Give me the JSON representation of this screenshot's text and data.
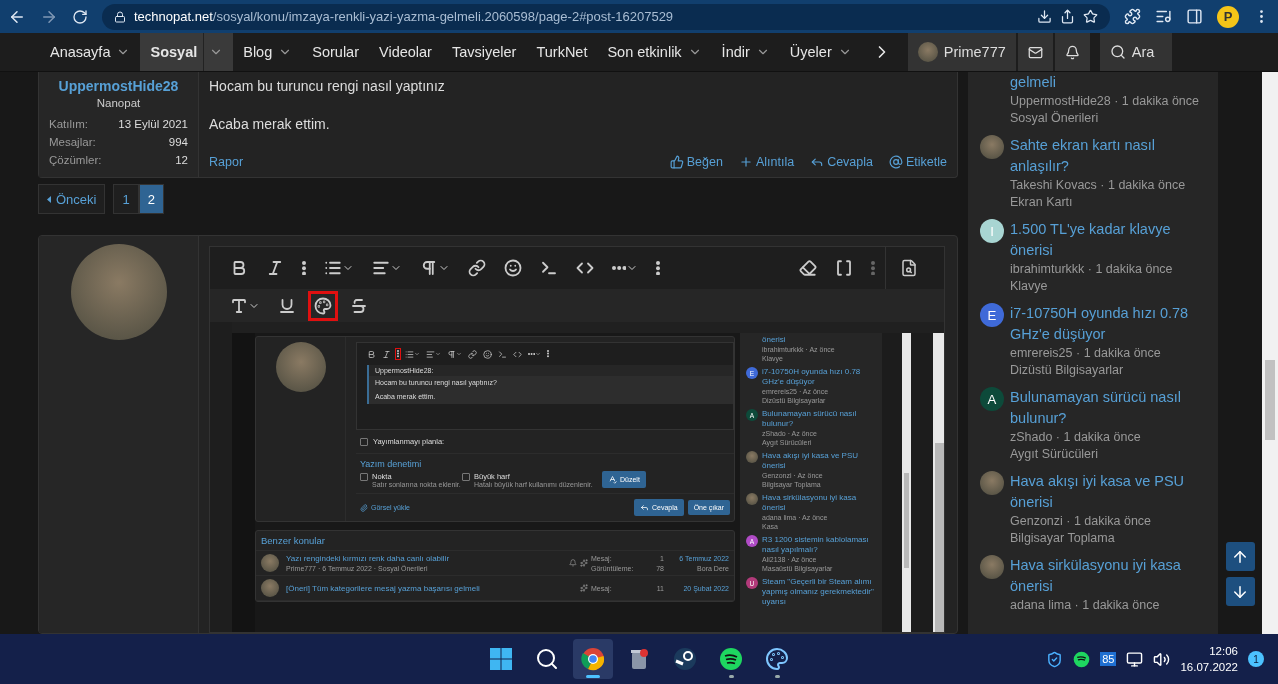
{
  "browser": {
    "url_host": "technopat.net",
    "url_path": "/sosyal/konu/imzaya-renkli-yazi-yazma-gelmeli.2060598/page-2#post-16207529",
    "profile_initial": "P"
  },
  "nav": {
    "items": [
      {
        "label": "Anasayfa",
        "selected": false,
        "dropdown": true
      },
      {
        "label": "Sosyal",
        "selected": true,
        "dropdown": true
      },
      {
        "label": "Blog",
        "selected": false,
        "dropdown": true
      },
      {
        "label": "Sorular",
        "selected": false,
        "dropdown": false
      },
      {
        "label": "Videolar",
        "selected": false,
        "dropdown": false
      },
      {
        "label": "Tavsiyeler",
        "selected": false,
        "dropdown": false
      },
      {
        "label": "TurkNet",
        "selected": false,
        "dropdown": false
      },
      {
        "label": "Son etkinlik",
        "selected": false,
        "dropdown": true
      },
      {
        "label": "İndir",
        "selected": false,
        "dropdown": true
      },
      {
        "label": "Üyeler",
        "selected": false,
        "dropdown": true
      }
    ],
    "user": "Prime777",
    "search": "Ara"
  },
  "post": {
    "author": "UppermostHide28",
    "rank": "Nanopat",
    "stats": [
      {
        "label": "Katılım:",
        "value": "13 Eylül 2021"
      },
      {
        "label": "Mesajlar:",
        "value": "994"
      },
      {
        "label": "Çözümler:",
        "value": "12"
      }
    ],
    "paragraphs": [
      "Hocam bu turuncu rengi nasıl yaptınız",
      "Acaba merak ettim."
    ],
    "report": "Rapor",
    "actions": [
      {
        "kind": "like",
        "label": "Beğen"
      },
      {
        "kind": "quote",
        "label": "Alıntıla"
      },
      {
        "kind": "reply",
        "label": "Cevapla"
      },
      {
        "kind": "mention",
        "label": "Etiketle"
      }
    ]
  },
  "pagination": {
    "prev": "Önceki",
    "pages": [
      {
        "label": "1",
        "selected": false
      },
      {
        "label": "2",
        "selected": true
      }
    ]
  },
  "editor": {
    "toolbar_rows": [
      {
        "tools": [
          {
            "kind": "bold",
            "highlighted": false,
            "dropdown": false
          },
          {
            "kind": "italic",
            "highlighted": false,
            "dropdown": false
          },
          {
            "kind": "more",
            "highlighted": false,
            "dropdown": false
          },
          {
            "kind": "list",
            "highlighted": false,
            "dropdown": true
          },
          {
            "kind": "align",
            "highlighted": false,
            "dropdown": true
          },
          {
            "kind": "paragraph",
            "highlighted": false,
            "dropdown": true
          },
          {
            "kind": "link",
            "highlighted": false,
            "dropdown": false
          },
          {
            "kind": "emoji",
            "highlighted": false,
            "dropdown": false
          },
          {
            "kind": "terminal",
            "highlighted": false,
            "dropdown": false
          },
          {
            "kind": "code",
            "highlighted": false,
            "dropdown": false
          },
          {
            "kind": "insert",
            "highlighted": false,
            "dropdown": true
          },
          {
            "kind": "more",
            "highlighted": false,
            "dropdown": false
          }
        ]
      },
      {
        "tools": [
          {
            "kind": "textsize",
            "highlighted": false,
            "dropdown": true
          },
          {
            "kind": "underline",
            "highlighted": false,
            "dropdown": false
          },
          {
            "kind": "palette",
            "highlighted": true,
            "dropdown": false
          },
          {
            "kind": "strike",
            "highlighted": false,
            "dropdown": false
          }
        ]
      }
    ],
    "right_tools": [
      {
        "kind": "eraser",
        "highlighted": false,
        "dropdown": false
      },
      {
        "kind": "brackets",
        "highlighted": false,
        "dropdown": false
      }
    ],
    "embedded_screenshot": {
      "toolbar": [
        {
          "kind": "bold",
          "highlighted": false,
          "dropdown": false
        },
        {
          "kind": "italic",
          "highlighted": false,
          "dropdown": false
        },
        {
          "kind": "more",
          "highlighted": true,
          "dropdown": false
        },
        {
          "kind": "list",
          "highlighted": false,
          "dropdown": true
        },
        {
          "kind": "align",
          "highlighted": false,
          "dropdown": true
        },
        {
          "kind": "paragraph",
          "highlighted": false,
          "dropdown": true
        },
        {
          "kind": "link",
          "highlighted": false,
          "dropdown": false
        },
        {
          "kind": "emoji",
          "highlighted": false,
          "dropdown": false
        },
        {
          "kind": "terminal",
          "highlighted": false,
          "dropdown": false
        },
        {
          "kind": "code",
          "highlighted": false,
          "dropdown": false
        },
        {
          "kind": "insert",
          "highlighted": false,
          "dropdown": true
        },
        {
          "kind": "more",
          "highlighted": false,
          "dropdown": false
        }
      ],
      "quote_author": "UppermostHide28:",
      "quote_lines": [
        "Hocam bu turuncu rengi nasıl yaptınız?",
        "Acaba merak ettim."
      ],
      "schedule": {
        "label": "Yayımlanmayı planla:",
        "checked": false
      },
      "spell_title": "Yazım denetimi",
      "spell_options": [
        {
          "label": "Nokta",
          "hint": "Satır sonlarına nokta eklenir.",
          "checked": false
        },
        {
          "label": "Büyük harf",
          "hint": "Hatalı büyük harf kullanımı düzenlenir.",
          "checked": false
        }
      ],
      "fix_button": "Düzelt",
      "upload": "Görsel yükle",
      "buttons": [
        {
          "kind": "reply",
          "label": "Cevapla"
        },
        {
          "kind": "plain",
          "label": "Öne çıkar"
        }
      ],
      "similar": {
        "title": "Benzer konular",
        "rows": [
          {
            "kind": "photo",
            "title": "Yazı rengindeki kırmızı renk daha canlı olabilir",
            "meta": "Prime777 · 6 Temmuz 2022 · Sosyal Önerileri",
            "watched": true,
            "stats": [
              {
                "label": "Mesaj:",
                "value": "1"
              },
              {
                "label": "Görüntüleme:",
                "value": "78"
              }
            ],
            "date": "6 Temmuz 2022",
            "last_user": "Bora Dere"
          },
          {
            "kind": "photo",
            "title": "[Öneri] Tüm kategorilere mesaj yazma başarısı gelmeli",
            "watched": false,
            "stats": [
              {
                "label": "Mesaj:",
                "value": "11"
              }
            ],
            "date": "20 Şubat 2022"
          }
        ]
      },
      "sidebar": [
        {
          "kind": "text_only",
          "title": "önerisi",
          "meta": "ibrahimturkkk · Az önce",
          "category": "Klavye"
        },
        {
          "kind": "letter",
          "letter": "E",
          "color": "#3f6ad8",
          "title": "i7-10750H oyunda hızı 0.78 GHz'e düşüyor",
          "meta": "emrereis25 · Az önce",
          "category": "Dizüstü Bilgisayarlar"
        },
        {
          "kind": "letter",
          "letter": "A",
          "color": "#0d4a3a",
          "title": "Bulunamayan sürücü nasıl bulunur?",
          "meta": "zShado · Az önce",
          "category": "Aygıt Sürücüleri"
        },
        {
          "kind": "photo",
          "title": "Hava akışı iyi kasa ve PSU önerisi",
          "meta": "Genzonzi · Az önce",
          "category": "Bilgisayar Toplama"
        },
        {
          "kind": "photo",
          "title": "Hava sirkülasyonu iyi kasa önerisi",
          "meta": "adana lima · Az önce",
          "category": "Kasa"
        },
        {
          "kind": "letter",
          "letter": "A",
          "color": "#b04bc6",
          "title": "R3 1200 sistemin kablolaması nasıl yapılmalı?",
          "meta": "Ali2138 · Az önce",
          "category": "Masaüstü Bilgisayarlar"
        },
        {
          "kind": "letter",
          "letter": "U",
          "color": "#b23a7a",
          "title": "Steam \"Geçerli bir Steam alımı yapmış olmanız gerekmektedir\" uyarısı"
        }
      ]
    }
  },
  "sidebar": [
    {
      "kind": "text_only",
      "title": "gelmeli",
      "meta": "UppermostHide28 · 1 dakika önce",
      "category": "Sosyal Önerileri"
    },
    {
      "kind": "photo",
      "title": "Sahte ekran kartı nasıl anlaşılır?",
      "meta": "Takeshi Kovacs · 1 dakika önce",
      "category": "Ekran Kartı"
    },
    {
      "kind": "letter",
      "letter": "I",
      "color": "#a8d5d2",
      "title": "1.500 TL'ye kadar klavye önerisi",
      "meta": "ibrahimturkkk · 1 dakika önce",
      "category": "Klavye"
    },
    {
      "kind": "letter",
      "letter": "E",
      "color": "#3f6ad8",
      "title": "i7-10750H oyunda hızı 0.78 GHz'e düşüyor",
      "meta": "emrereis25 · 1 dakika önce",
      "category": "Dizüstü Bilgisayarlar"
    },
    {
      "kind": "letter",
      "letter": "A",
      "color": "#0d4a3a",
      "title": "Bulunamayan sürücü nasıl bulunur?",
      "meta": "zShado · 1 dakika önce",
      "category": "Aygıt Sürücüleri"
    },
    {
      "kind": "photo",
      "title": "Hava akışı iyi kasa ve PSU önerisi",
      "meta": "Genzonzi · 1 dakika önce",
      "category": "Bilgisayar Toplama"
    },
    {
      "kind": "photo",
      "title": "Hava sirkülasyonu iyi kasa önerisi",
      "meta": "adana lima · 1 dakika önce"
    }
  ],
  "taskbar": {
    "apps": [
      {
        "kind": "start",
        "active": false,
        "running": false
      },
      {
        "kind": "search",
        "active": false,
        "running": false
      },
      {
        "kind": "chrome",
        "active": true,
        "running": true
      },
      {
        "kind": "recycle",
        "active": false,
        "running": false
      },
      {
        "kind": "steam",
        "active": false,
        "running": false
      },
      {
        "kind": "spotify",
        "active": false,
        "running": true
      },
      {
        "kind": "paint",
        "active": false,
        "running": true
      }
    ],
    "tray_badge": "85",
    "time": "12:06",
    "date": "16.07.2022",
    "notifications": "1"
  }
}
